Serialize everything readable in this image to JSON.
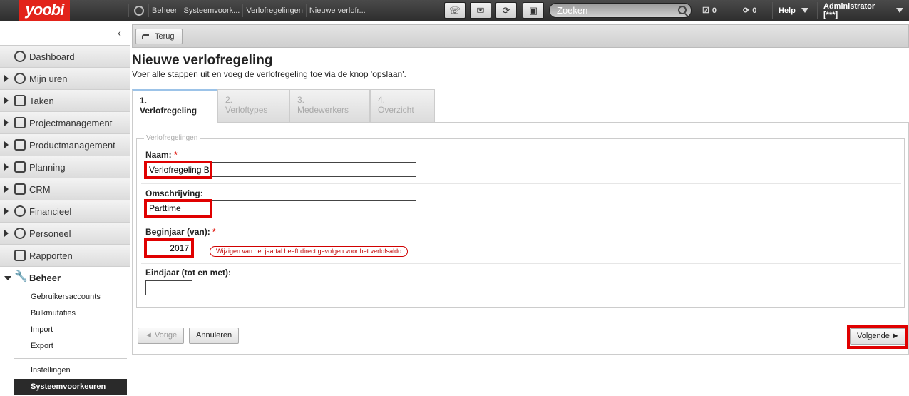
{
  "topbar": {
    "logo": "yoobi",
    "breadcrumbs": [
      "Beheer",
      "Systeemvoork...",
      "Verlofregelingen",
      "Nieuwe verlofr..."
    ],
    "search_placeholder": "Zoeken",
    "tasks_count": "0",
    "refresh_count": "0",
    "help_label": "Help",
    "user_label": "Administrator [***]"
  },
  "sidebar": {
    "items": [
      {
        "label": "Dashboard"
      },
      {
        "label": "Mijn uren"
      },
      {
        "label": "Taken"
      },
      {
        "label": "Projectmanagement"
      },
      {
        "label": "Productmanagement"
      },
      {
        "label": "Planning"
      },
      {
        "label": "CRM"
      },
      {
        "label": "Financieel"
      },
      {
        "label": "Personeel"
      },
      {
        "label": "Rapporten"
      }
    ],
    "beheer_label": "Beheer",
    "beheer_sub": [
      "Gebruikersaccounts",
      "Bulkmutaties",
      "Import",
      "Export"
    ],
    "settings_sub": [
      "Instellingen",
      "Systeemvoorkeuren"
    ]
  },
  "main": {
    "back_label": "Terug",
    "title": "Nieuwe verlofregeling",
    "subtitle": "Voer alle stappen uit en voeg de verlofregeling toe via de knop 'opslaan'.",
    "steps": [
      {
        "num": "1.",
        "label": "Verlofregeling"
      },
      {
        "num": "2.",
        "label": "Verloftypes"
      },
      {
        "num": "3.",
        "label": "Medewerkers"
      },
      {
        "num": "4.",
        "label": "Overzicht"
      }
    ],
    "legend": "Verlofregelingen",
    "fields": {
      "naam_label": "Naam:",
      "naam_value": "Verlofregeling B",
      "omschrijving_label": "Omschrijving:",
      "omschrijving_value": "Parttime",
      "beginjaar_label": "Beginjaar (van):",
      "beginjaar_value": "2017",
      "beginjaar_warning": "Wijzigen van het jaartal heeft direct gevolgen voor het verlofsaldo",
      "eindjaar_label": "Eindjaar (tot en met):",
      "eindjaar_value": ""
    },
    "required_marker": "*",
    "buttons": {
      "prev": "◄ Vorige",
      "cancel": "Annuleren",
      "next": "Volgende ►"
    }
  }
}
